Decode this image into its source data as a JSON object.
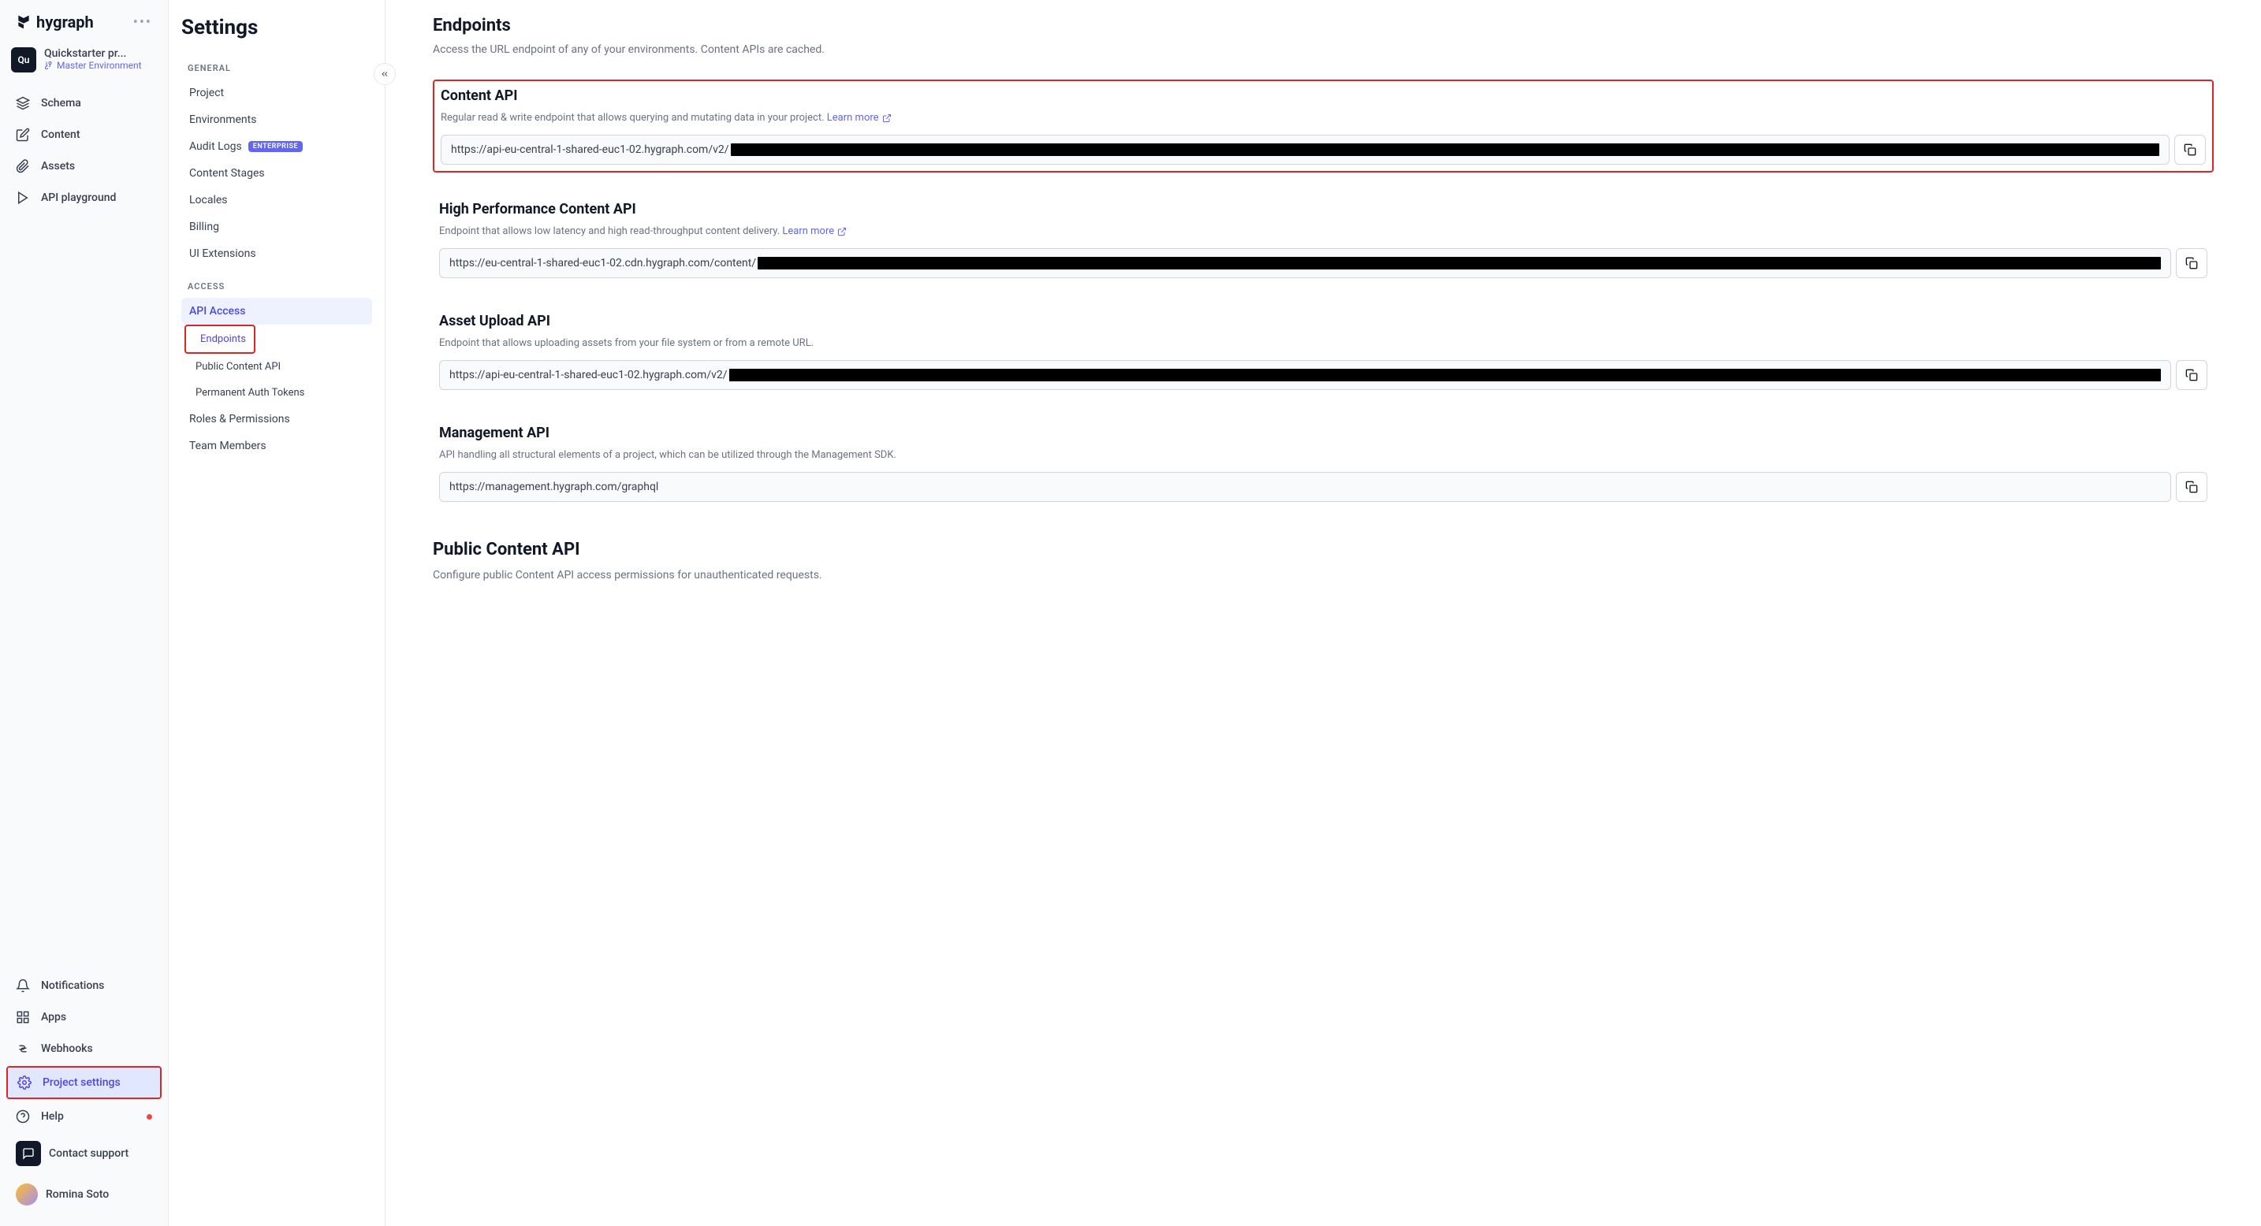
{
  "logo": "hygraph",
  "project": {
    "badge": "Qu",
    "name": "Quickstarter pr...",
    "env": "Master Environment"
  },
  "nav": {
    "schema": "Schema",
    "content": "Content",
    "assets": "Assets",
    "playground": "API playground",
    "notifications": "Notifications",
    "apps": "Apps",
    "webhooks": "Webhooks",
    "project_settings": "Project settings",
    "help": "Help",
    "contact_support": "Contact support",
    "user": "Romina Soto"
  },
  "settings": {
    "title": "Settings",
    "general_label": "GENERAL",
    "access_label": "ACCESS",
    "items": {
      "project": "Project",
      "environments": "Environments",
      "audit_logs": "Audit Logs",
      "audit_logs_badge": "ENTERPRISE",
      "content_stages": "Content Stages",
      "locales": "Locales",
      "billing": "Billing",
      "ui_extensions": "UI Extensions",
      "api_access": "API Access",
      "endpoints": "Endpoints",
      "public_content_api": "Public Content API",
      "permanent_auth_tokens": "Permanent Auth Tokens",
      "roles_permissions": "Roles & Permissions",
      "team_members": "Team Members"
    }
  },
  "main": {
    "endpoints_title": "Endpoints",
    "endpoints_desc": "Access the URL endpoint of any of your environments. Content APIs are cached.",
    "content_api": {
      "title": "Content API",
      "desc": "Regular read & write endpoint that allows querying and mutating data in your project. ",
      "learn_more": "Learn more",
      "url": "https://api-eu-central-1-shared-euc1-02.hygraph.com/v2/"
    },
    "hp_api": {
      "title": "High Performance Content API",
      "desc": "Endpoint that allows low latency and high read-throughput content delivery. ",
      "learn_more": "Learn more",
      "url": "https://eu-central-1-shared-euc1-02.cdn.hygraph.com/content/"
    },
    "asset_api": {
      "title": "Asset Upload API",
      "desc": "Endpoint that allows uploading assets from your file system or from a remote URL.",
      "url": "https://api-eu-central-1-shared-euc1-02.hygraph.com/v2/"
    },
    "mgmt_api": {
      "title": "Management API",
      "desc": "API handling all structural elements of a project, which can be utilized through the Management SDK.",
      "url": "https://management.hygraph.com/graphql"
    },
    "public_api": {
      "title": "Public Content API",
      "desc": "Configure public Content API access permissions for unauthenticated requests."
    }
  }
}
